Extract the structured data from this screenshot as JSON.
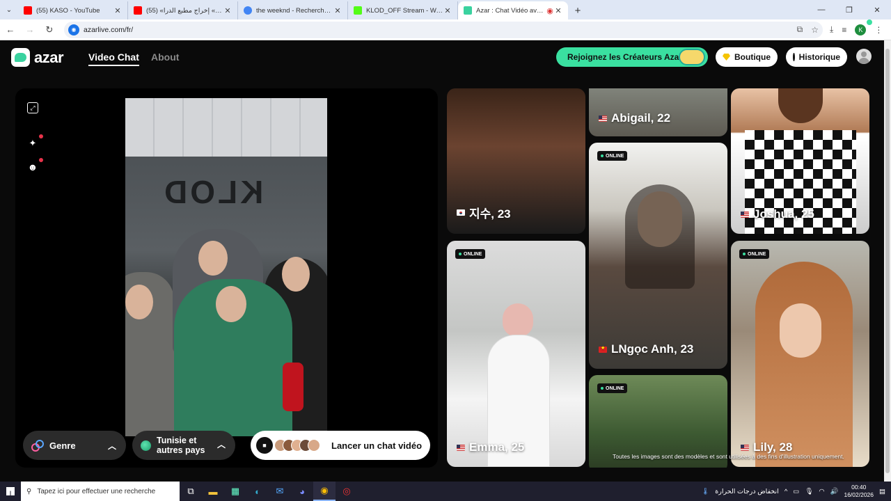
{
  "browser": {
    "tabs": [
      {
        "title": "(55) KASO - YouTube",
        "favicon_color": "#ff0000"
      },
      {
        "title": "(55) «أكسيدون» إخراج مطبع الدرا",
        "favicon_color": "#ff0000"
      },
      {
        "title": "the weeknd - Recherche Google",
        "favicon_color": "#4285f4"
      },
      {
        "title": "KLOD_OFF Stream - Watch Live",
        "favicon_color": "#53fc18"
      },
      {
        "title": "Azar : Chat Vidéo avec de n",
        "favicon_color": "#3ad29f",
        "active": true
      }
    ],
    "url": "azarlive.com/fr/",
    "profile_initial": "K"
  },
  "header": {
    "logo_text": "azar",
    "nav": {
      "video_chat": "Video Chat",
      "about": "About"
    },
    "creators_button": "Rejoignez les Créateurs Azar",
    "shop_button": "Boutique",
    "history_button": "Historique"
  },
  "video_panel": {
    "wall_text": "KLOD",
    "gender_filter": "Genre",
    "country_filter": "Tunisie et autres pays",
    "launch_button": "Lancer un chat vidéo"
  },
  "gallery": {
    "online_label": "ONLINE",
    "cards": [
      {
        "name": "지수, 23",
        "flag": "kr"
      },
      {
        "name": "Abigail, 22",
        "flag": "us"
      },
      {
        "name": "Joshua, 25",
        "flag": "us"
      },
      {
        "name": "LNgọc Anh, 23",
        "flag": "vn"
      },
      {
        "name": "Emma, 25",
        "flag": "us"
      },
      {
        "name": "Lily, 28",
        "flag": "us"
      }
    ],
    "disclaimer": "Toutes les images sont des modèles et sont utilisées à des fins d'illustration uniquement."
  },
  "taskbar": {
    "search_placeholder": "Tapez ici pour effectuer une recherche",
    "weather": "انخفاض درجات الحرارة",
    "time": "00:40",
    "date": "16/02/2026"
  },
  "colors": {
    "accent": "#3ae0a0",
    "bg": "#0a0a0a"
  }
}
